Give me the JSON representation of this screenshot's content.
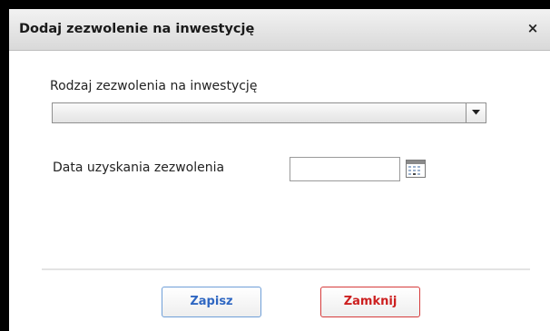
{
  "dialog": {
    "title": "Dodaj zezwolenie na inwestycję",
    "close_label": "×"
  },
  "form": {
    "type_label": "Rodzaj zezwolenia na inwestycję",
    "type_value": "",
    "date_label": "Data uzyskania zezwolenia",
    "date_value": ""
  },
  "buttons": {
    "save": "Zapisz",
    "close": "Zamknij"
  },
  "icons": {
    "dropdown": "chevron-down-icon",
    "calendar": "calendar-icon",
    "close": "close-icon"
  },
  "colors": {
    "save_accent": "#2f67c2",
    "close_accent": "#cc1f1f"
  }
}
